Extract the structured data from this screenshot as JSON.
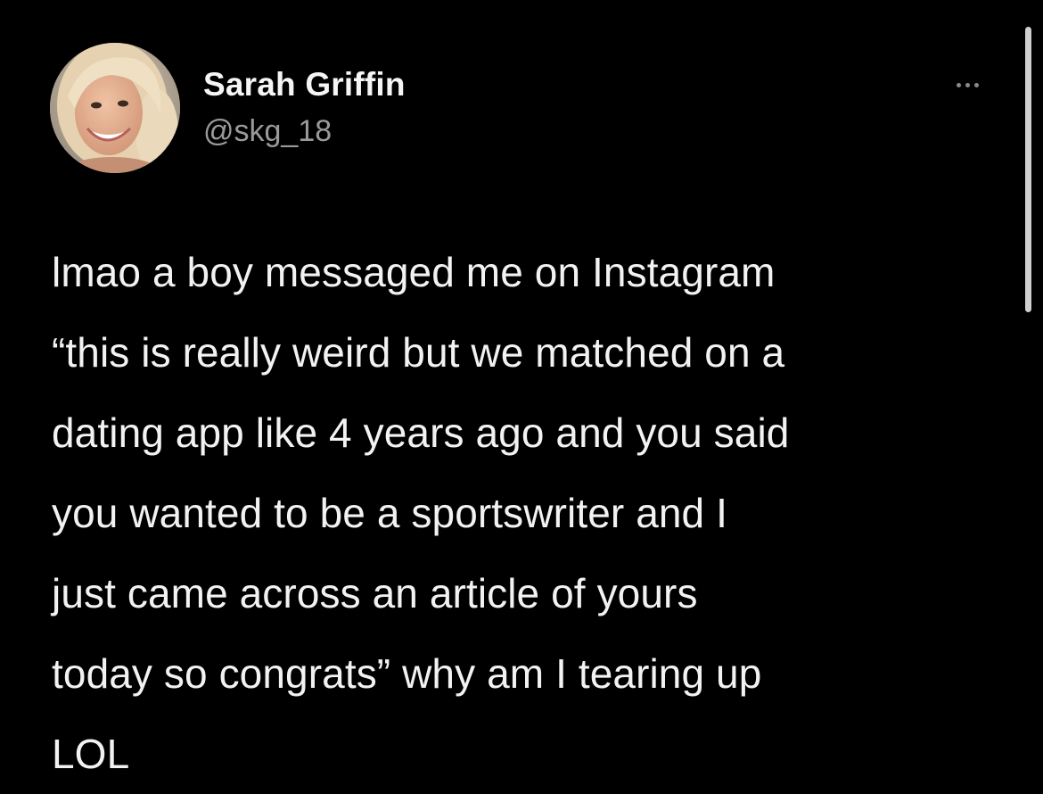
{
  "tweet": {
    "author": {
      "display_name": "Sarah Griffin",
      "handle": "@skg_18",
      "avatar_icon": "profile-photo"
    },
    "more_icon": "ellipsis-icon",
    "text_lines": [
      "lmao a boy messaged me on Instagram",
      "“this is really weird but we matched on a",
      "dating app like 4 years ago and you said",
      "you wanted to be a sportswriter and I",
      "just came across an article of yours",
      "today so congrats” why am I tearing up",
      "LOL"
    ]
  },
  "colors": {
    "background": "#000000",
    "text": "#f2f2f2",
    "handle": "#9a9a9a",
    "scrollbar": "#cfcfcf"
  }
}
